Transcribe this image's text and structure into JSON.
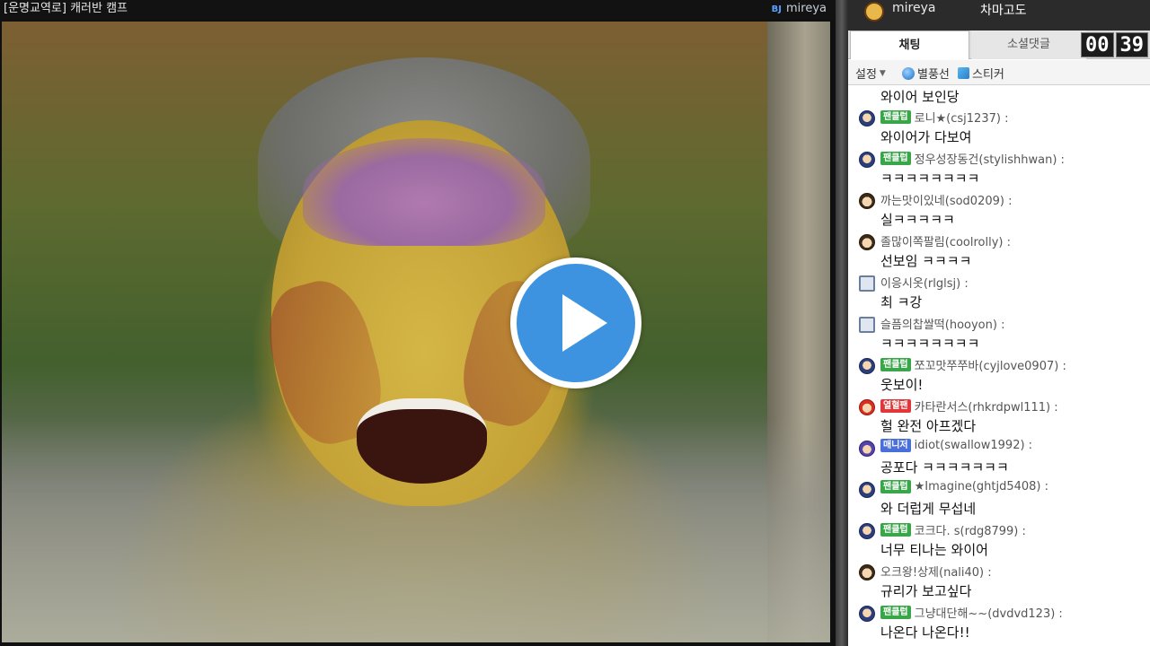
{
  "player": {
    "title": "[운명교역로] 캐러반 캠프",
    "bj_tag": "BJ",
    "bj_name": "mireya"
  },
  "side": {
    "bj_name": "mireya",
    "status": "차마고도",
    "tabs": [
      {
        "label": "채팅",
        "active": true
      },
      {
        "label": "소셜댓글",
        "active": false
      }
    ],
    "timer": {
      "minutes": "00",
      "seconds": "39"
    },
    "toolbar": {
      "settings": "설정",
      "balloon": "별풍선",
      "sticker": "스티커"
    }
  },
  "colors": {
    "play_button": "#3d93e0",
    "fan_badge": "#3aa64a",
    "hot_badge": "#e0383a",
    "manager_badge": "#4a6fd8"
  },
  "chat": {
    "cut_message": "와이어 보인당",
    "messages": [
      {
        "icon": "fan",
        "badge": "팬클럽",
        "user": "로니★(csj1237) :",
        "text": "와이어가 다보여"
      },
      {
        "icon": "fan",
        "badge": "팬클럽",
        "user": "정우성장동건(stylishhwan) :",
        "text": "ㅋㅋㅋㅋㅋㅋㅋㅋ"
      },
      {
        "icon": "plain",
        "badge": "",
        "user": "까는맛이있네(sod0209) :",
        "text": "실ㅋㅋㅋㅋㅋ"
      },
      {
        "icon": "plain",
        "badge": "",
        "user": "졸많이쪽팔림(coolrolly) :",
        "text": "선보임 ㅋㅋㅋㅋ"
      },
      {
        "icon": "mobile",
        "badge": "",
        "user": "이응시옷(rlglsj) :",
        "text": "최 ㅋ강"
      },
      {
        "icon": "mobile",
        "badge": "",
        "user": "슬픔의찹쌀떡(hooyon) :",
        "text": "ㅋㅋㅋㅋㅋㅋㅋㅋ"
      },
      {
        "icon": "fan",
        "badge": "팬클럽",
        "user": "쪼꼬맛쭈쭈바(cyjlove0907) :",
        "text": "웃보이!"
      },
      {
        "icon": "hot",
        "badge": "열혈팬",
        "user": "카타란서스(rhkrdpwl111) :",
        "text": "헐 완전 아프겠다"
      },
      {
        "icon": "manager",
        "badge": "매니저",
        "user": "idiot(swallow1992) :",
        "text": "공포다 ㅋㅋㅋㅋㅋㅋㅋ"
      },
      {
        "icon": "fan",
        "badge": "팬클럽",
        "user": "★Imagine(ghtjd5408) :",
        "text": "와 더럽게 무섭네"
      },
      {
        "icon": "fan",
        "badge": "팬클럽",
        "user": "코크다. s(rdg8799) :",
        "text": "너무 티나는 와이어"
      },
      {
        "icon": "plain",
        "badge": "",
        "user": "오크왕!상제(nali40) :",
        "text": "규리가 보고싶다"
      },
      {
        "icon": "fan",
        "badge": "팬클럽",
        "user": "그냥대단해~~(dvdvd123) :",
        "text": "나온다 나온다!!"
      }
    ]
  }
}
